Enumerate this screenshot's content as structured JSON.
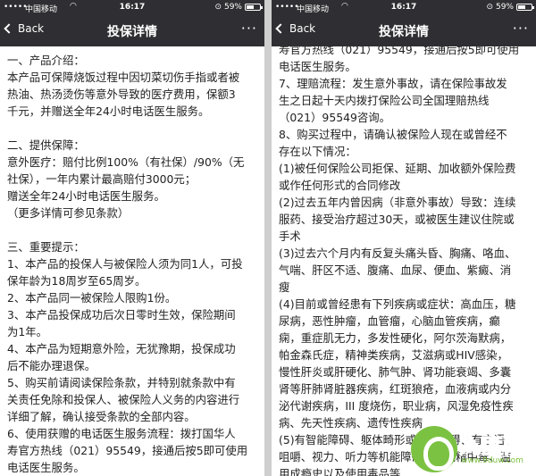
{
  "status": {
    "carrier": "中国移动",
    "time": "16:17",
    "battery": "59%",
    "battery_level": 0.59
  },
  "nav": {
    "back_label": "Back",
    "title": "投保详情",
    "more_label": "···"
  },
  "left_lines": [
    "一、产品介绍：",
    "本产品可保障烧饭过程中因切菜切伤手指或者被",
    "热油、热汤烫伤等意外导致的医疗费用，保额3",
    "千元，并赠送全年24小时电话医生服务。",
    "",
    "二、提供保障：",
    "意外医疗：赔付比例100%（有社保）/90%（无",
    "社保），一年内累计最高赔付3000元；",
    "赠送全年24小时电话医生服务。",
    "（更多详情可参见条款）",
    "",
    "三、重要提示：",
    "1、本产品的投保人与被保险人须为同1人，可投",
    "保年龄为18周岁至65周岁。",
    "2、本产品同一被保险人限购1份。",
    "3、本产品投保成功后次日零时生效，保险期间",
    "为1年。",
    "4、本产品为短期意外险，无犹豫期，投保成功",
    "后不能办理退保。",
    "5、购买前请阅读保险条款，并特别就条款中有",
    "关责任免除和投保人、被保险人义务的内容进行",
    "详细了解，确认接受条款的全部内容。",
    "6、使用获赠的电话医生服务流程：拨打国华人",
    "寿官方热线（021）95549，接通后按5即可使用",
    "电话医生服务。"
  ],
  "right_lines": [
    "寿官方热线（021）95549，接通后按5即可使用",
    "电话医生服务。",
    "7、理赔流程：发生意外事故，请在保险事故发",
    "生之日起十天内拨打保险公司全国理赔热线",
    "（021）95549咨询。",
    "8、购买过程中，请确认被保险人现在或曾经不",
    "存在以下情况：",
    "(1)被任何保险公司拒保、延期、加收额外保险费",
    "或作任何形式的合同修改",
    "(2)过去五年内曾因病（非意外事故）导致：连续",
    "服药、接受治疗超过30天，或被医生建议住院或",
    "手术",
    "(3)过去六个月内有反复头痛头昏、胸痛、咯血、",
    "气喘、肝区不适、腹痛、血尿、便血、紫癜、消",
    "瘦",
    "(4)目前或曾经患有下列疾病或症状：高血压，糖",
    "尿病，恶性肿瘤，血管瘤，心脑血管疾病，癫",
    "痫，重症肌无力，多发性硬化，阿尔茨海默病，",
    "帕金森氏症，精神类疾病，艾滋病或HIV感染，",
    "慢性肝炎或肝硬化、肺气肿、肾功能衰竭、多囊",
    "肾等肝肺肾脏器疾病，红斑狼疮，血液病或内分",
    "泌代谢疾病，III 度烧伤，职业病，风湿免疫性疾",
    "病、先天性疾病、遗传性疾病",
    "(5)有智能障碍、躯体畸形或功能障碍、有言语、",
    "咀嚼、视力、听力等机能障碍，有酒精中毒、滥",
    "用成瘾史以及使用毒品等"
  ],
  "watermark": {
    "text": "九度网",
    "url": "www.9duw.com",
    "color": "#7cc242"
  }
}
